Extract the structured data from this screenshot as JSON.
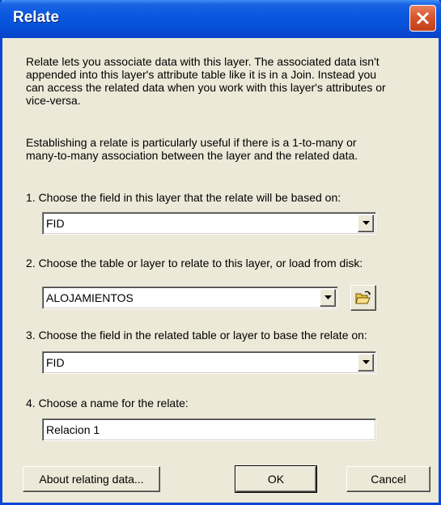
{
  "window": {
    "title": "Relate"
  },
  "intro": {
    "paragraph1": "Relate lets you associate data with this layer. The associated data isn't\nappended into this layer's attribute table like it is in a Join. Instead you\ncan access the related data when you work with this layer's attributes or\nvice-versa.",
    "paragraph2": "Establishing a relate is particularly useful if there is a 1-to-many or\nmany-to-many association between the layer and the related data."
  },
  "step1": {
    "label": "1. Choose the field in this layer that the relate will be based on:",
    "value": "FID"
  },
  "step2": {
    "label": "2. Choose the table or layer to relate to this layer, or load from disk:",
    "value": "ALOJAMIENTOS"
  },
  "step3": {
    "label": "3. Choose the field in the related table or layer to base the relate on:",
    "value": "FID"
  },
  "step4": {
    "label": "4. Choose a name for the relate:",
    "value": "Relacion 1"
  },
  "buttons": {
    "about": "About relating data...",
    "ok": "OK",
    "cancel": "Cancel"
  },
  "icons": {
    "close": "close-icon",
    "dropdown": "dropdown-arrow-icon",
    "open_folder": "open-folder-icon"
  },
  "colors": {
    "titlebar": "#0A58E0",
    "close_button": "#D8552E",
    "dialog_background": "#ECE9D8"
  }
}
